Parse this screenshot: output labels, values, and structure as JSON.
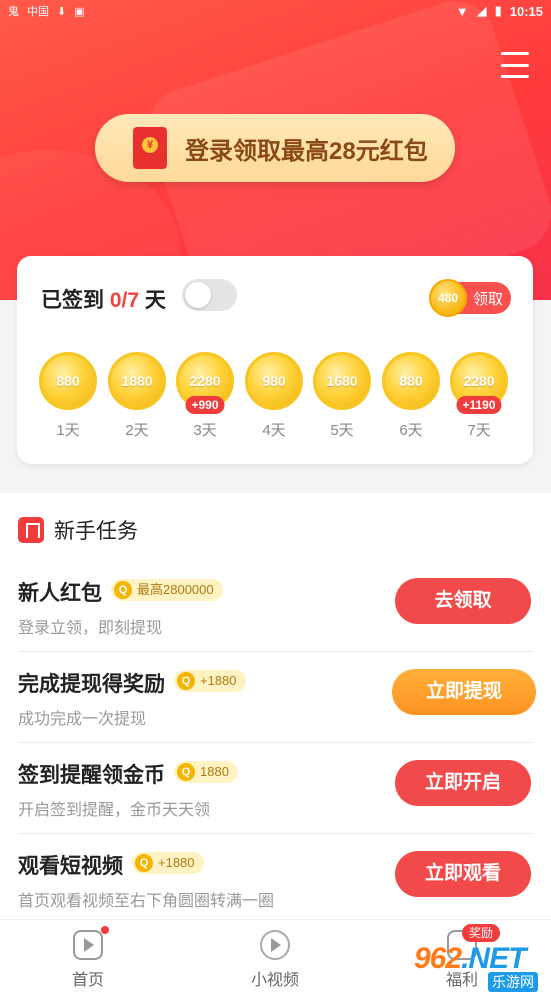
{
  "status_bar": {
    "carrier_icons": "鬼",
    "small_text": "中国",
    "time": "10:15"
  },
  "header": {
    "banner_text": "登录领取最高28元红包"
  },
  "checkin": {
    "title_prefix": "已签到 ",
    "count": "0/7",
    "title_suffix": " 天",
    "claim_coin": "480",
    "claim_label": "领取",
    "days": [
      {
        "amount": "880",
        "label": "1天",
        "bonus": ""
      },
      {
        "amount": "1880",
        "label": "2天",
        "bonus": ""
      },
      {
        "amount": "2280",
        "label": "3天",
        "bonus": "+990"
      },
      {
        "amount": "980",
        "label": "4天",
        "bonus": ""
      },
      {
        "amount": "1680",
        "label": "5天",
        "bonus": ""
      },
      {
        "amount": "880",
        "label": "6天",
        "bonus": ""
      },
      {
        "amount": "2280",
        "label": "7天",
        "bonus": "+1190"
      }
    ]
  },
  "tasks": {
    "title": "新手任务",
    "items": [
      {
        "name": "新人红包",
        "reward": "最高2800000",
        "desc": "登录立领，即刻提现",
        "button": "去领取"
      },
      {
        "name": "完成提现得奖励",
        "reward": "+1880",
        "desc": "成功完成一次提现",
        "button": "立即提现"
      },
      {
        "name": "签到提醒领金币",
        "reward": "1880",
        "desc": "开启签到提醒，金币天天领",
        "button": "立即开启"
      },
      {
        "name": "观看短视频",
        "reward": "+1880",
        "desc": "首页观看视频至右下角圆圈转满一圈",
        "button": "立即观看"
      }
    ]
  },
  "nav": {
    "home": "首页",
    "short_video": "小视频",
    "welfare": "福利",
    "welfare_badge": "奖励"
  },
  "watermark": {
    "logo": "962",
    "domain": ".NET",
    "sub": "乐游网"
  },
  "colors": {
    "primary": "#f23b3b",
    "accent_orange": "#ff9a24",
    "gold": "#f4b400"
  }
}
